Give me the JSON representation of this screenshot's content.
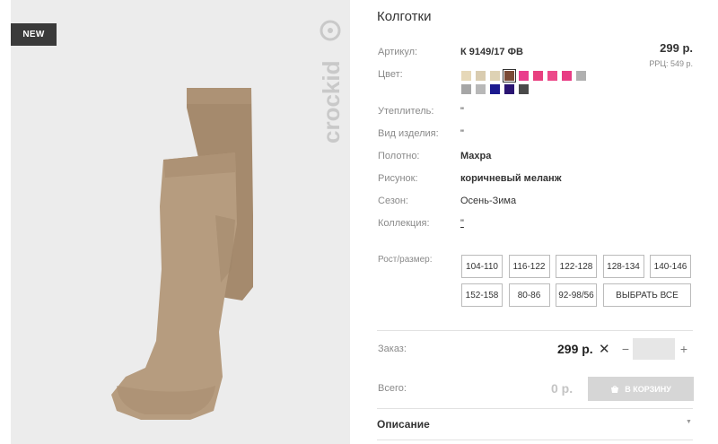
{
  "product": {
    "badge": "NEW",
    "brand": "crockid",
    "title": "Колготки",
    "price": "299 р.",
    "rrc": "РРЦ: 549 р."
  },
  "specs": {
    "article_label": "Артикул:",
    "article_value": "К 9149/17 ФВ",
    "color_label": "Цвет:",
    "insulation_label": "Утеплитель:",
    "insulation_value": "\"",
    "type_label": "Вид изделия:",
    "type_value": "\"",
    "fabric_label": "Полотно:",
    "fabric_value": "Махра",
    "pattern_label": "Рисунок:",
    "pattern_value": "коричневый меланж",
    "season_label": "Сезон:",
    "season_value": "Осень-Зима",
    "collection_label": "Коллекция:",
    "collection_value": "\"",
    "size_label": "Рост/размер:"
  },
  "swatches": {
    "selected_index": 3,
    "colors": [
      "#e6d8b8",
      "#d9ccb0",
      "#ded2b4",
      "#7b4a36",
      "#e93d8c",
      "#e8407f",
      "#ec4a8a",
      "#e83c84",
      "#b0b0b0",
      "#a6a6a6",
      "#b8b8b8",
      "#1c1a8f",
      "#2a1472",
      "#4a4a4a"
    ]
  },
  "sizes": [
    "104-110",
    "116-122",
    "122-128",
    "128-134",
    "140-146",
    "152-158",
    "80-86",
    "92-98/56"
  ],
  "select_all_label": "ВЫБРАТЬ ВСЕ",
  "order": {
    "label": "Заказ:",
    "price": "299 р.",
    "times": "✕",
    "minus": "−",
    "plus": "+",
    "quantity": ""
  },
  "total": {
    "label": "Всего:",
    "value": "0 р.",
    "cart_label": "В КОРЗИНУ"
  },
  "description": {
    "label": "Описание",
    "caret": "▼"
  },
  "colors": {
    "tights": "#b59b7e",
    "tights_shade": "#a68b6e",
    "panel_bg": "#ececec",
    "badge_bg": "#3a3a3a"
  }
}
